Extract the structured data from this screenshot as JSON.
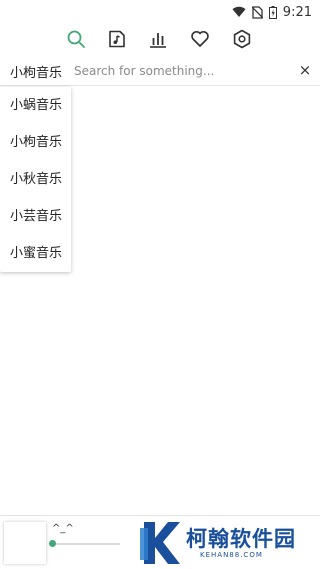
{
  "status_bar": {
    "time": "9:21",
    "icons": [
      "wifi-icon",
      "no-sim-icon",
      "battery-icon"
    ]
  },
  "nav": {
    "icons": [
      "search-icon",
      "music-file-icon",
      "chart-icon",
      "heart-icon",
      "settings-icon"
    ],
    "active": "search-icon",
    "accent_color": "#43a77a"
  },
  "search": {
    "source_selected": "小枸音乐",
    "placeholder": "Search for something...",
    "value": "",
    "clear_label": "×"
  },
  "dropdown": {
    "options": [
      "小蜗音乐",
      "小枸音乐",
      "小秋音乐",
      "小芸音乐",
      "小蜜音乐"
    ]
  },
  "player": {
    "title": "^_^",
    "progress": 0
  },
  "watermark": {
    "text": "柯翰软件园",
    "subtext": "KEHAN88.COM",
    "color": "#1a4f9c"
  }
}
